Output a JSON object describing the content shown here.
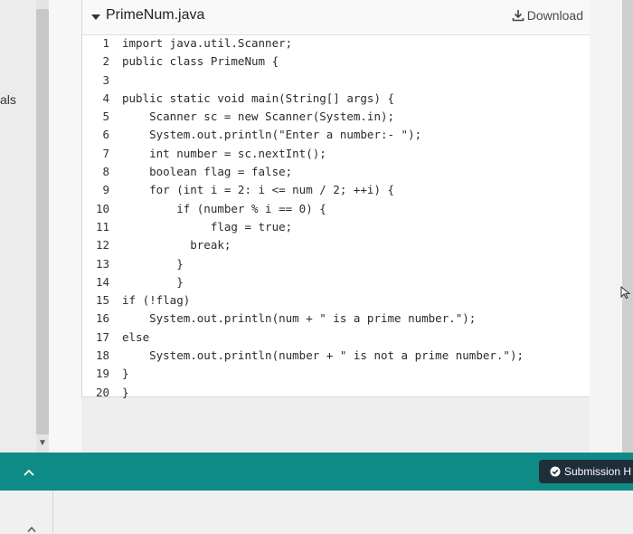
{
  "side": {
    "label": "als"
  },
  "file": {
    "name": "PrimeNum.java",
    "download_label": "Download"
  },
  "code_lines": [
    {
      "num": "1",
      "text": "import java.util.Scanner;"
    },
    {
      "num": "2",
      "text": "public class PrimeNum {"
    },
    {
      "num": "3",
      "text": ""
    },
    {
      "num": "4",
      "text": "public static void main(String[] args) {"
    },
    {
      "num": "5",
      "text": "    Scanner sc = new Scanner(System.in);"
    },
    {
      "num": "6",
      "text": "    System.out.println(\"Enter a number:- \");"
    },
    {
      "num": "7",
      "text": "    int number = sc.nextInt();"
    },
    {
      "num": "8",
      "text": "    boolean flag = false;"
    },
    {
      "num": "9",
      "text": "    for (int i = 2: i <= num / 2; ++i) {"
    },
    {
      "num": "10",
      "text": "        if (number % i == 0) {"
    },
    {
      "num": "11",
      "text": "             flag = true;"
    },
    {
      "num": "12",
      "text": "          break;"
    },
    {
      "num": "13",
      "text": "        }"
    },
    {
      "num": "14",
      "text": "        }"
    },
    {
      "num": "15",
      "text": "if (!flag)"
    },
    {
      "num": "16",
      "text": "    System.out.println(num + \" is a prime number.\");"
    },
    {
      "num": "17",
      "text": "else"
    },
    {
      "num": "18",
      "text": "    System.out.println(number + \" is not a prime number.\");"
    },
    {
      "num": "19",
      "text": "}"
    },
    {
      "num": "20",
      "text": "}"
    }
  ],
  "footer": {
    "submission_label": "Submission H"
  },
  "colors": {
    "teal": "#0e8b87",
    "dark_button": "#1f2f3a"
  }
}
